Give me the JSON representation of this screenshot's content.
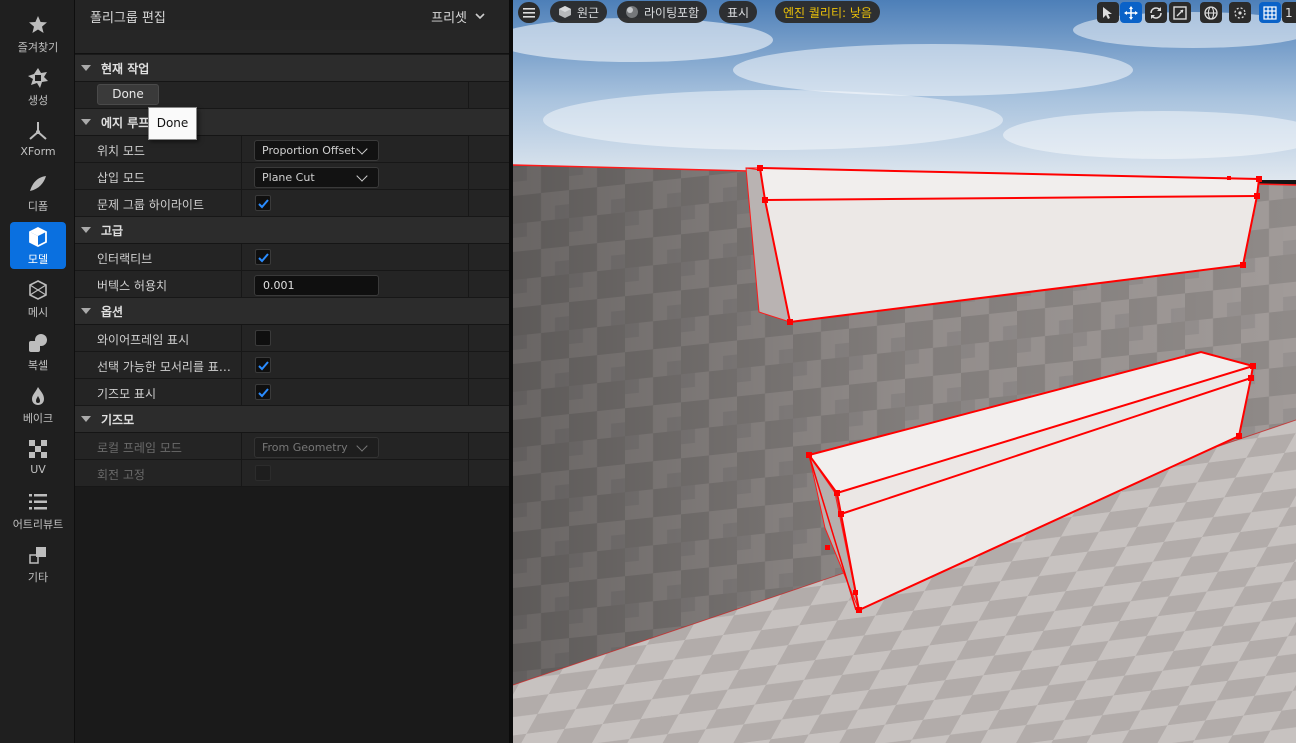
{
  "toolbar": {
    "items": [
      {
        "label": "즐겨찾기",
        "icon": "star-icon"
      },
      {
        "label": "생성",
        "icon": "create-icon"
      },
      {
        "label": "XForm",
        "icon": "transform-icon"
      },
      {
        "label": "디폼",
        "icon": "deform-icon"
      },
      {
        "label": "모델",
        "icon": "model-icon"
      },
      {
        "label": "메시",
        "icon": "mesh-icon"
      },
      {
        "label": "복셀",
        "icon": "voxel-icon"
      },
      {
        "label": "베이크",
        "icon": "bake-icon"
      },
      {
        "label": "UV",
        "icon": "uv-icon"
      },
      {
        "label": "어트리뷰트",
        "icon": "attributes-icon"
      },
      {
        "label": "기타",
        "icon": "misc-icon"
      }
    ],
    "active_index": 4
  },
  "panel": {
    "title": "폴리그룹 편집",
    "preset_label": "프리셋",
    "sections": {
      "current": "현재 작업",
      "edge_loop": "에지 루프 삽",
      "advanced": "고급",
      "options": "옵션",
      "gizmo": "기즈모"
    },
    "done_label": "Done",
    "tooltip": "Done",
    "rows": {
      "position_mode": {
        "label": "위치 모드",
        "value": "Proportion Offset"
      },
      "insert_mode": {
        "label": "삽입 모드",
        "value": "Plane Cut"
      },
      "highlight_problem": {
        "label": "문제 그룹 하이라이트",
        "checked": true
      },
      "interactive": {
        "label": "인터랙티브",
        "checked": true
      },
      "vertex_tolerance": {
        "label": "버텍스 허용치",
        "value": "0.001"
      },
      "show_wireframe": {
        "label": "와이어프레임 표시",
        "checked": false
      },
      "show_selectable_edges": {
        "label": "선택 가능한 모서리를 표시합...",
        "checked": true
      },
      "show_gizmo": {
        "label": "기즈모 표시",
        "checked": true
      },
      "local_frame_mode": {
        "label": "로컬 프레임 모드",
        "value": "From Geometry"
      },
      "lock_rotation": {
        "label": "회전 고정",
        "checked": false
      }
    }
  },
  "viewport": {
    "menu_icon": "hamburger-icon",
    "perspective_label": "원근",
    "lighting_label": "라이팅포함",
    "show_label": "표시",
    "quality_label": "엔진 퀄리티: 낮음",
    "quality_color": "#f2c400",
    "grid_value": "1",
    "accent": "#0a70e0",
    "edge_color": "#ff0000"
  }
}
